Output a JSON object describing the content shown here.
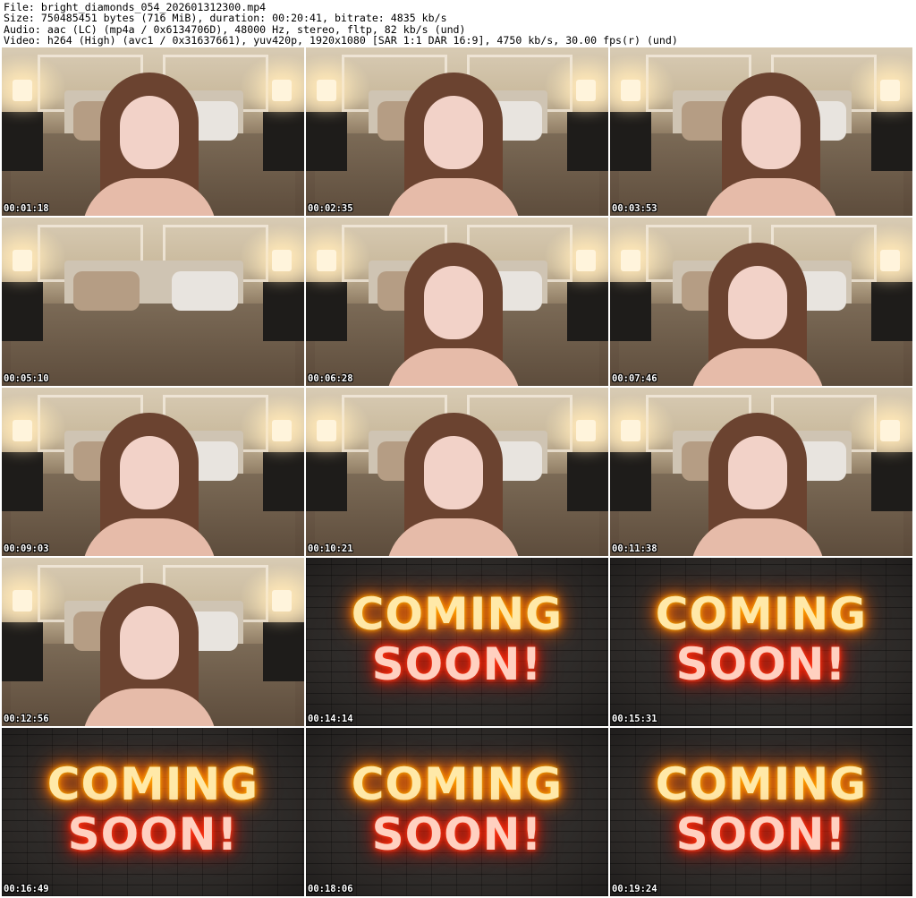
{
  "header": {
    "file_line": "File: bright_diamonds_054_202601312300.mp4",
    "size_line": "Size: 750485451 bytes (716 MiB), duration: 00:20:41, bitrate: 4835 kb/s",
    "audio_line": "Audio: aac (LC) (mp4a / 0x6134706D), 48000 Hz, stereo, fltp, 82 kb/s (und)",
    "video_line": "Video: h264 (High) (avc1 / 0x31637661), yuv420p, 1920x1080 [SAR 1:1 DAR 16:9], 4750 kb/s, 30.00 fps(r) (und)"
  },
  "thumbnails": [
    {
      "timestamp": "00:01:18",
      "scene": "room-person"
    },
    {
      "timestamp": "00:02:35",
      "scene": "room-person"
    },
    {
      "timestamp": "00:03:53",
      "scene": "room-person"
    },
    {
      "timestamp": "00:05:10",
      "scene": "room-empty"
    },
    {
      "timestamp": "00:06:28",
      "scene": "room-person"
    },
    {
      "timestamp": "00:07:46",
      "scene": "room-person"
    },
    {
      "timestamp": "00:09:03",
      "scene": "room-person"
    },
    {
      "timestamp": "00:10:21",
      "scene": "room-person"
    },
    {
      "timestamp": "00:11:38",
      "scene": "room-person"
    },
    {
      "timestamp": "00:12:56",
      "scene": "room-person"
    },
    {
      "timestamp": "00:14:14",
      "scene": "coming-soon"
    },
    {
      "timestamp": "00:15:31",
      "scene": "coming-soon"
    },
    {
      "timestamp": "00:16:49",
      "scene": "coming-soon"
    },
    {
      "timestamp": "00:18:06",
      "scene": "coming-soon"
    },
    {
      "timestamp": "00:19:24",
      "scene": "coming-soon"
    }
  ],
  "neon_sign": {
    "line1": "COMING",
    "line2": "SOON!"
  },
  "colors": {
    "neon_orange": "#ff8a00",
    "neon_red": "#ff2a0a",
    "timestamp_text": "#ffffff"
  }
}
